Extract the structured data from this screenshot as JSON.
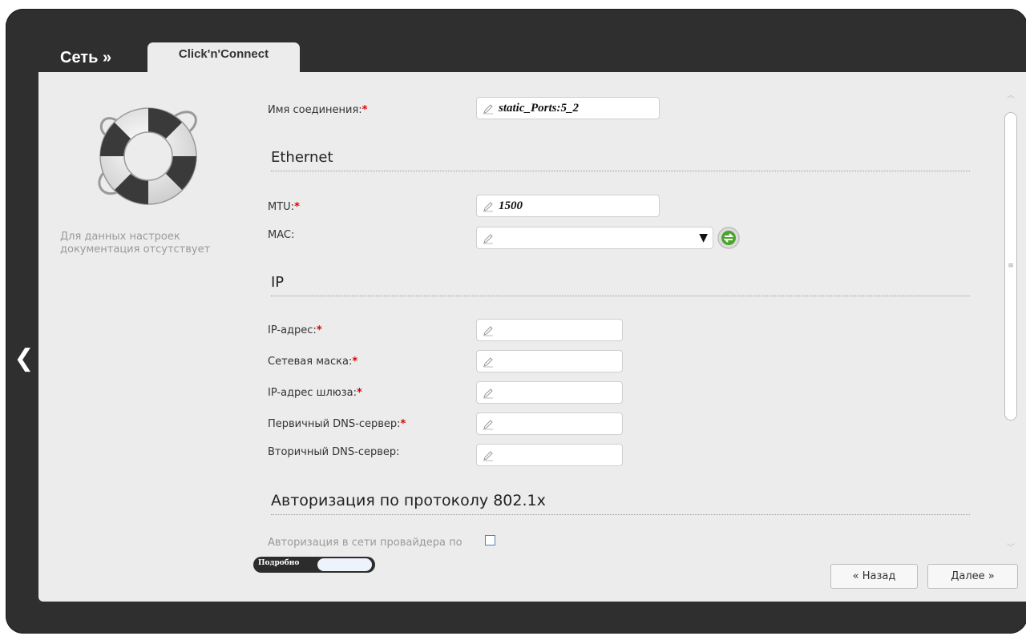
{
  "header": {
    "breadcrumb": "Сеть »",
    "tab_label": "Click'n'Connect"
  },
  "sidebar": {
    "help_text": "Для данных настроек документация отсутствует"
  },
  "form": {
    "required_mark": "*",
    "connection_name": {
      "label": "Имя соединения:",
      "value": "static_Ports:5_2"
    },
    "ethernet": {
      "title": "Ethernet",
      "mtu": {
        "label": "MTU:",
        "value": "1500"
      },
      "mac": {
        "label": "MAC:",
        "value": ""
      }
    },
    "ip": {
      "title": "IP",
      "ip_address": {
        "label": "IP-адрес:",
        "value": ""
      },
      "netmask": {
        "label": "Сетевая маска:",
        "value": ""
      },
      "gateway": {
        "label": "IP-адрес шлюза:",
        "value": ""
      },
      "dns_primary": {
        "label": "Первичный DNS-сервер:",
        "value": ""
      },
      "dns_secondary": {
        "label": "Вторичный DNS-сервер:",
        "value": ""
      }
    },
    "auth": {
      "title": "Авторизация по протоколу 802.1x",
      "checkbox_label": "Авторизация в сети провайдера по",
      "checked": false
    }
  },
  "footer": {
    "details_toggle": "Подробно",
    "back_button": "« Назад",
    "next_button": "Далее »"
  },
  "icons": {
    "back": "chevron-left-icon",
    "edit": "pencil-icon",
    "refresh": "refresh-icon",
    "help": "lifebuoy-icon"
  },
  "colors": {
    "frame": "#2f2f2f",
    "panel": "#ececec",
    "required": "#e00000",
    "refresh_green": "#4aa52a"
  }
}
